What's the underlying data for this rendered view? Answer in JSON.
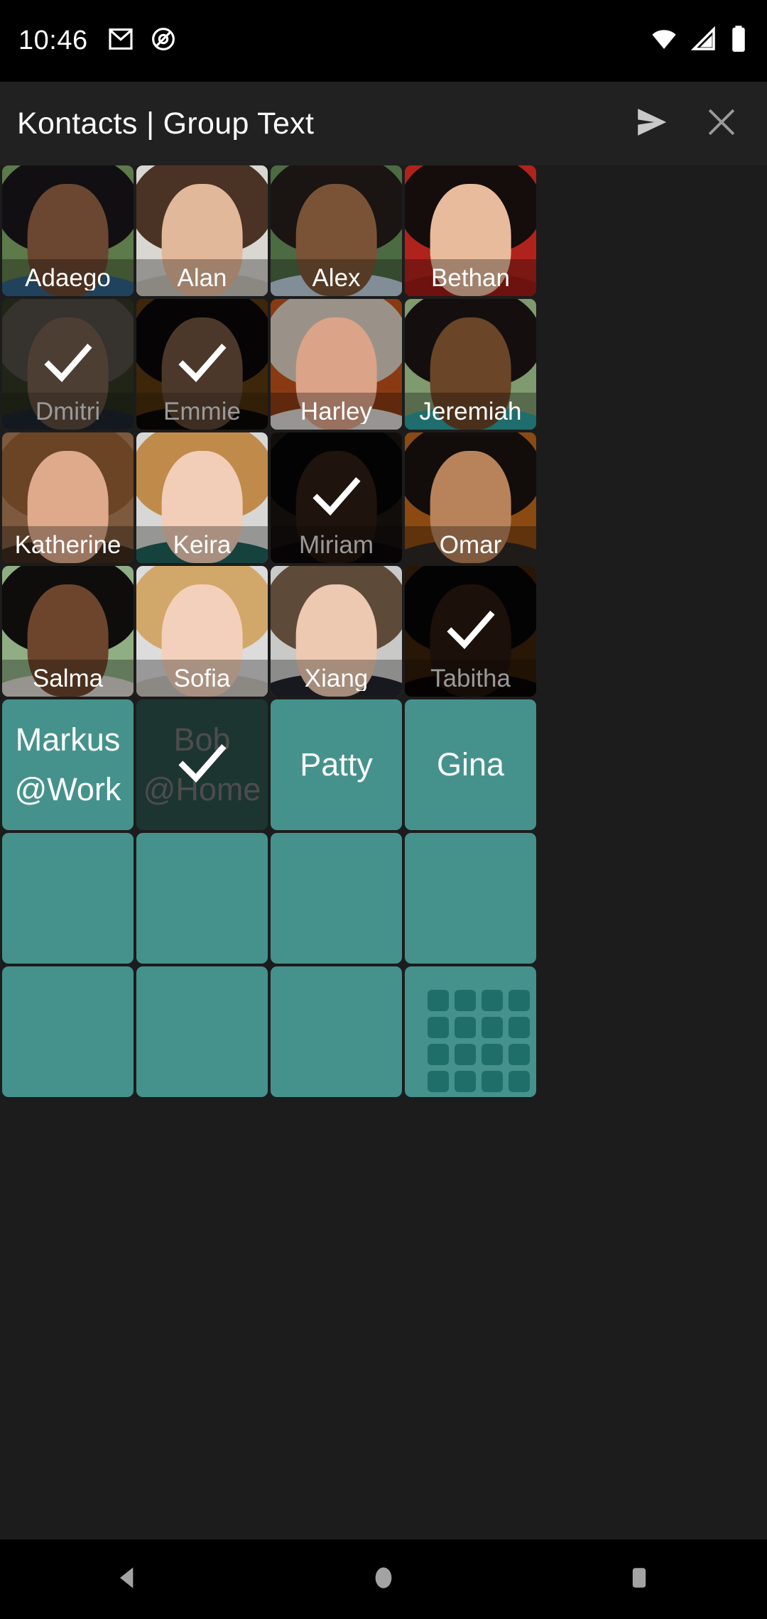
{
  "statusbar": {
    "time": "10:46",
    "left_icons": [
      "gmail-icon",
      "circle-slash-icon"
    ],
    "right_icons": [
      "wifi-icon",
      "cell-signal-icon",
      "battery-icon"
    ]
  },
  "appbar": {
    "title": "Kontacts | Group Text",
    "actions": [
      {
        "name": "send-button",
        "icon": "send-icon"
      },
      {
        "name": "close-button",
        "icon": "close-icon"
      }
    ]
  },
  "colors": {
    "teal": "#45928d",
    "teal_selected": "#1d3531",
    "grid_icon": "#1f6e69",
    "appbar_bg": "#212121",
    "page_bg": "#1c1c1c"
  },
  "contacts": [
    {
      "name": "Adaego",
      "selected": false,
      "bg": "#5d7a4a",
      "hair": "#120f12",
      "face": "#6b4630",
      "shoulders": "#2f5f86"
    },
    {
      "name": "Alan",
      "selected": false,
      "bg": "#d9d7d2",
      "hair": "#4a3324",
      "face": "#e2b89a",
      "shoulders": "#c8c3bb"
    },
    {
      "name": "Alex",
      "selected": false,
      "bg": "#4c6b43",
      "hair": "#1a1412",
      "face": "#7a5336",
      "shoulders": "#b9cbd8"
    },
    {
      "name": "Bethan",
      "selected": false,
      "bg": "#b0231d",
      "hair": "#140d0c",
      "face": "#e8bb9c",
      "shoulders": "#9e1b16"
    },
    {
      "name": "Dmitri",
      "selected": true,
      "bg": "#56613f",
      "hair": "#8e8577",
      "face": "#caa286",
      "shoulders": "#42536b"
    },
    {
      "name": "Emmie",
      "selected": true,
      "bg": "#a0651b",
      "hair": "#100c0c",
      "face": "#c99470",
      "shoulders": "#1a1212"
    },
    {
      "name": "Harley",
      "selected": false,
      "bg": "#8a3a12",
      "hair": "#9a9288",
      "face": "#dba387",
      "shoulders": "#d8d5d0"
    },
    {
      "name": "Jeremiah",
      "selected": false,
      "bg": "#7f9a6e",
      "hair": "#140f0e",
      "face": "#6a4527",
      "shoulders": "#2f9c9c"
    },
    {
      "name": "Katherine",
      "selected": false,
      "bg": "#7d5a3e",
      "hair": "#6b4426",
      "face": "#dfa98b",
      "shoulders": "#3c2a1d"
    },
    {
      "name": "Keira",
      "selected": false,
      "bg": "#d7d8d6",
      "hair": "#c08b4a",
      "face": "#f2cdb7",
      "shoulders": "#1f5f58"
    },
    {
      "name": "Miriam",
      "selected": true,
      "bg": "#2a231f",
      "hair": "#0d0a09",
      "face": "#4f3222",
      "shoulders": "#171110"
    },
    {
      "name": "Omar",
      "selected": false,
      "bg": "#8a4a12",
      "hair": "#120d0b",
      "face": "#b8835b",
      "shoulders": "#2d2724"
    },
    {
      "name": "Salma",
      "selected": false,
      "bg": "#8fae84",
      "hair": "#0f0c0c",
      "face": "#6d452c",
      "shoulders": "#d8d4cd"
    },
    {
      "name": "Sofia",
      "selected": false,
      "bg": "#dcdcdc",
      "hair": "#d2a86a",
      "face": "#f3d0bb",
      "shoulders": "#c9c5bf"
    },
    {
      "name": "Xiang",
      "selected": false,
      "bg": "#c9c9c7",
      "hair": "#5e4a39",
      "face": "#ecc9b0",
      "shoulders": "#22252b"
    },
    {
      "name": "Tabitha",
      "selected": true,
      "bg": "#6b3a12",
      "hair": "#0c0909",
      "face": "#4a2c1c",
      "shoulders": "#100b0a"
    }
  ],
  "groups": [
    {
      "line1": "Markus",
      "line2": "@Work",
      "selected": false,
      "empty": false,
      "gridicon": false
    },
    {
      "line1": "Bob",
      "line2": "@Home",
      "selected": true,
      "empty": false,
      "gridicon": false
    },
    {
      "line1": "Patty",
      "line2": "",
      "selected": false,
      "empty": false,
      "gridicon": false
    },
    {
      "line1": "Gina",
      "line2": "",
      "selected": false,
      "empty": false,
      "gridicon": false
    },
    {
      "line1": "",
      "line2": "",
      "selected": false,
      "empty": true,
      "gridicon": false
    },
    {
      "line1": "",
      "line2": "",
      "selected": false,
      "empty": true,
      "gridicon": false
    },
    {
      "line1": "",
      "line2": "",
      "selected": false,
      "empty": true,
      "gridicon": false
    },
    {
      "line1": "",
      "line2": "",
      "selected": false,
      "empty": true,
      "gridicon": false
    },
    {
      "line1": "",
      "line2": "",
      "selected": false,
      "empty": true,
      "gridicon": false
    },
    {
      "line1": "",
      "line2": "",
      "selected": false,
      "empty": true,
      "gridicon": false
    },
    {
      "line1": "",
      "line2": "",
      "selected": false,
      "empty": true,
      "gridicon": false
    },
    {
      "line1": "",
      "line2": "",
      "selected": false,
      "empty": true,
      "gridicon": true
    }
  ],
  "navbar": {
    "items": [
      {
        "name": "back-button",
        "icon": "back-triangle-icon"
      },
      {
        "name": "home-button",
        "icon": "home-circle-icon"
      },
      {
        "name": "recents-button",
        "icon": "recents-square-icon"
      }
    ]
  }
}
